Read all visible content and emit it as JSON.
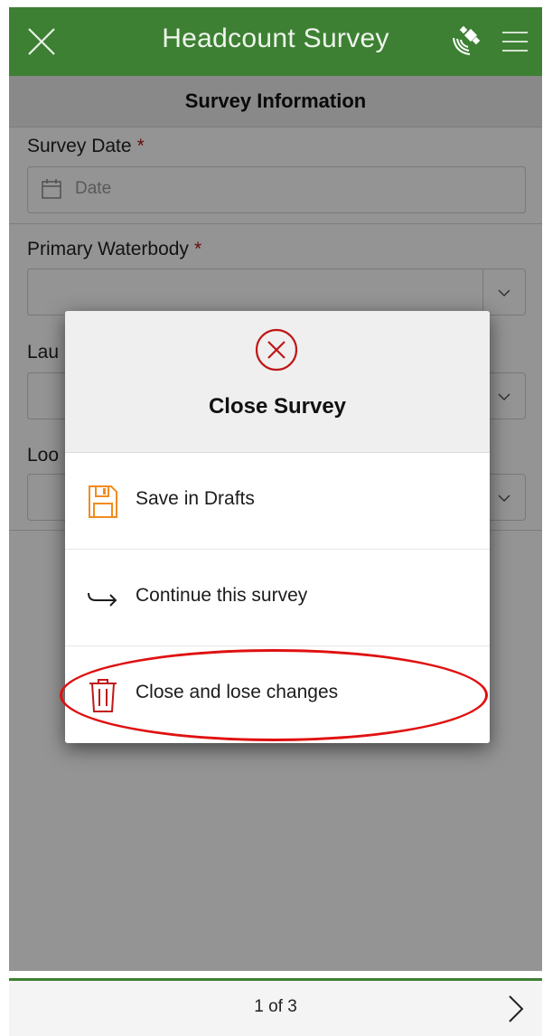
{
  "header": {
    "title": "Headcount Survey",
    "close_icon": "close-icon",
    "satellite_icon": "satellite-gps-icon",
    "menu_icon": "hamburger-menu-icon",
    "color": "#3d8033"
  },
  "section": {
    "title": "Survey Information"
  },
  "fields": {
    "survey_date": {
      "label": "Survey Date",
      "required": "*",
      "placeholder": "Date"
    },
    "primary_waterbody": {
      "label": "Primary Waterbody",
      "required": "*",
      "value": ""
    },
    "launch": {
      "label_visible": "Lau"
    },
    "location": {
      "label_visible": "Loo"
    }
  },
  "dialog": {
    "title": "Close Survey",
    "options": [
      {
        "label": "Save in Drafts",
        "icon": "floppy-disk-icon",
        "color": "#f08c1e"
      },
      {
        "label": "Continue this survey",
        "icon": "return-arrow-icon",
        "color": "#1c1c1c"
      },
      {
        "label": "Close and lose changes",
        "icon": "trash-icon",
        "color": "#c01818"
      }
    ],
    "highlight_color": "#e01010"
  },
  "footer": {
    "page_indicator": "1 of 3",
    "next_icon": "chevron-right-icon"
  }
}
